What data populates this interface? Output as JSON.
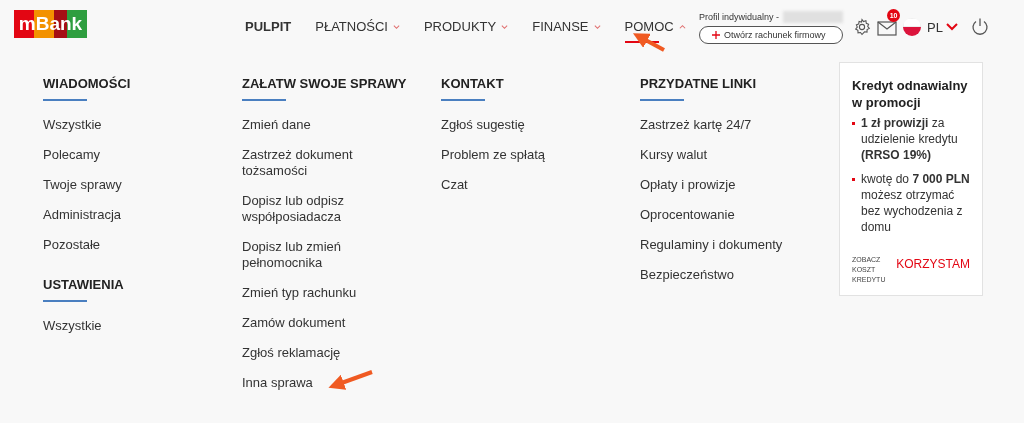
{
  "logo": {
    "text": "mBank"
  },
  "nav": [
    {
      "label": "PULPIT",
      "active": true,
      "dropdown": false,
      "expanded": false
    },
    {
      "label": "PŁATNOŚCI",
      "active": false,
      "dropdown": true,
      "expanded": false
    },
    {
      "label": "PRODUKTY",
      "active": false,
      "dropdown": true,
      "expanded": false
    },
    {
      "label": "FINANSE",
      "active": false,
      "dropdown": true,
      "expanded": false
    },
    {
      "label": "POMOC",
      "active": false,
      "dropdown": true,
      "expanded": true
    }
  ],
  "profile": {
    "label": "Profil indywidualny -",
    "button": "Otwórz rachunek firmowy",
    "messages_badge": "10",
    "language": "PL"
  },
  "menu_columns": [
    {
      "sections": [
        {
          "title": "WIADOMOŚCI",
          "items": [
            "Wszystkie",
            "Polecamy",
            "Twoje sprawy",
            "Administracja",
            "Pozostałe"
          ]
        },
        {
          "title": "USTAWIENIA",
          "items": [
            "Wszystkie"
          ]
        }
      ]
    },
    {
      "sections": [
        {
          "title": "ZAŁATW SWOJE SPRAWY",
          "items": [
            "Zmień dane",
            "Zastrzeż dokument tożsamości",
            "Dopisz lub odpisz współposiadacza",
            "Dopisz lub zmień pełnomocnika",
            "Zmień typ rachunku",
            "Zamów dokument",
            "Zgłoś reklamację",
            "Inna sprawa"
          ]
        }
      ]
    },
    {
      "sections": [
        {
          "title": "KONTAKT",
          "items": [
            "Zgłoś sugestię",
            "Problem ze spłatą",
            "Czat"
          ]
        }
      ]
    },
    {
      "sections": [
        {
          "title": "PRZYDATNE LINKI",
          "items": [
            "Zastrzeż kartę 24/7",
            "Kursy walut",
            "Opłaty i prowizje",
            "Oprocentowanie",
            "Regulaminy i dokumenty",
            "Bezpieczeństwo"
          ]
        }
      ]
    }
  ],
  "promo": {
    "title": "Kredyt odnawialny w promocji",
    "bullets": [
      "**1 zł prowizji** za udzielenie kredytu **(RRSO 19%)**",
      "kwotę do **7 000 PLN** możesz otrzymać bez wychodzenia z domu"
    ],
    "cost_link": "ZOBACZ KOSZT KREDYTU",
    "cta": "KORZYSTAM"
  }
}
